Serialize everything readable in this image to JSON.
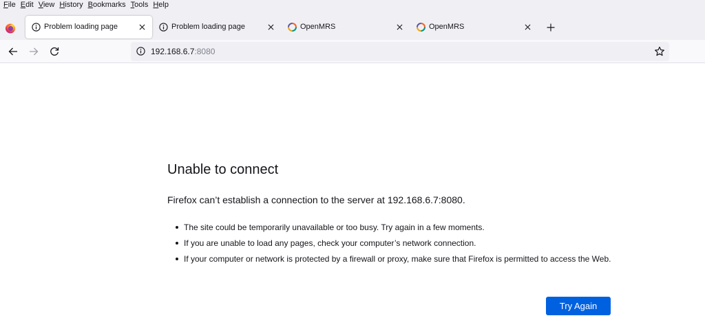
{
  "menubar": {
    "items": [
      {
        "accel": "F",
        "rest": "ile"
      },
      {
        "accel": "E",
        "rest": "dit"
      },
      {
        "accel": "V",
        "rest": "iew"
      },
      {
        "accel": "H",
        "rest": "istory"
      },
      {
        "accel": "B",
        "rest": "ookmarks"
      },
      {
        "accel": "T",
        "rest": "ools"
      },
      {
        "accel": "H",
        "rest": "elp"
      }
    ]
  },
  "tabs": [
    {
      "label": "Problem loading page",
      "icon": "info-icon",
      "active": true
    },
    {
      "label": "Problem loading page",
      "icon": "info-icon",
      "active": false
    },
    {
      "label": "OpenMRS",
      "icon": "openmrs-logo-icon",
      "active": false
    },
    {
      "label": "OpenMRS",
      "icon": "openmrs-logo-icon",
      "active": false
    }
  ],
  "navbar": {
    "url_host": "192.168.6.7",
    "url_port": ":8080"
  },
  "error": {
    "title": "Unable to connect",
    "description": "Firefox can’t establish a connection to the server at 192.168.6.7:8080.",
    "items": [
      "The site could be temporarily unavailable or too busy. Try again in a few moments.",
      "If you are unable to load any pages, check your computer’s network connection.",
      "If your computer or network is protected by a firewall or proxy, make sure that Firefox is permitted to access the Web."
    ],
    "button_label": "Try Again"
  },
  "colors": {
    "accent": "#0061e0",
    "chrome_bg": "#f0f0f4",
    "text": "#15141a"
  }
}
